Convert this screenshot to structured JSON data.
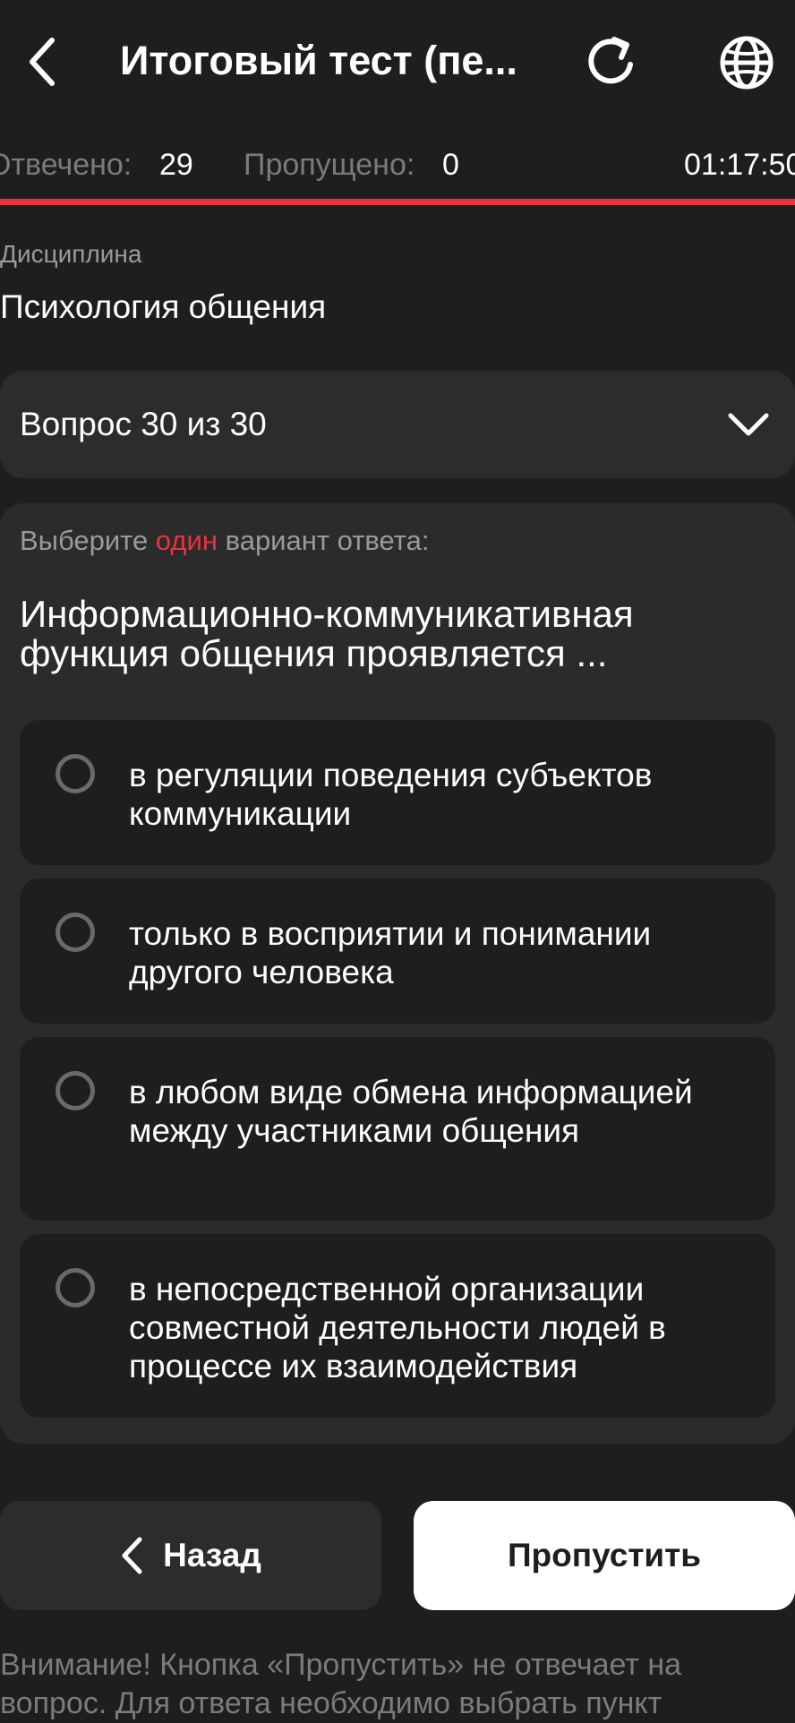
{
  "header": {
    "title": "Итоговый тест (пе...",
    "back_icon": "chevron-left-icon",
    "reload_icon": "reload-icon",
    "language_icon": "globe-icon"
  },
  "stats": {
    "answered_label": "Отвечено:",
    "answered_value": "29",
    "skipped_label": "Пропущено:",
    "skipped_value": "0",
    "timer": "01:17:50"
  },
  "progress": {
    "fraction": 1.0,
    "color": "#e8333f"
  },
  "discipline": {
    "label": "Дисциплина",
    "value": "Психология общения"
  },
  "question_selector": {
    "label": "Вопрос 30 из 30",
    "icon": "chevron-down-icon"
  },
  "question": {
    "instruction_before": "Выберите ",
    "instruction_highlight": "один",
    "instruction_after": " вариант ответа:",
    "text": "Информационно-коммуникативная функция общения проявляется ...",
    "options": [
      {
        "label": "в регуляции поведения субъектов коммуникации",
        "selected": false
      },
      {
        "label": "только в восприятии и понимании другого человека",
        "selected": false
      },
      {
        "label": "в любом виде обмена информацией между участниками общения",
        "selected": false
      },
      {
        "label": "в непосредственной организации совместной деятельности людей в процессе их взаимодействия",
        "selected": false
      }
    ]
  },
  "actions": {
    "back_label": "Назад",
    "skip_label": "Пропустить"
  },
  "warning": "Внимание! Кнопка «Пропустить» не отвечает на вопрос. Для ответа необходимо выбрать пункт",
  "colors": {
    "background": "#1e1e1e",
    "accent": "#e8333f",
    "card": "#2b2b2b"
  }
}
